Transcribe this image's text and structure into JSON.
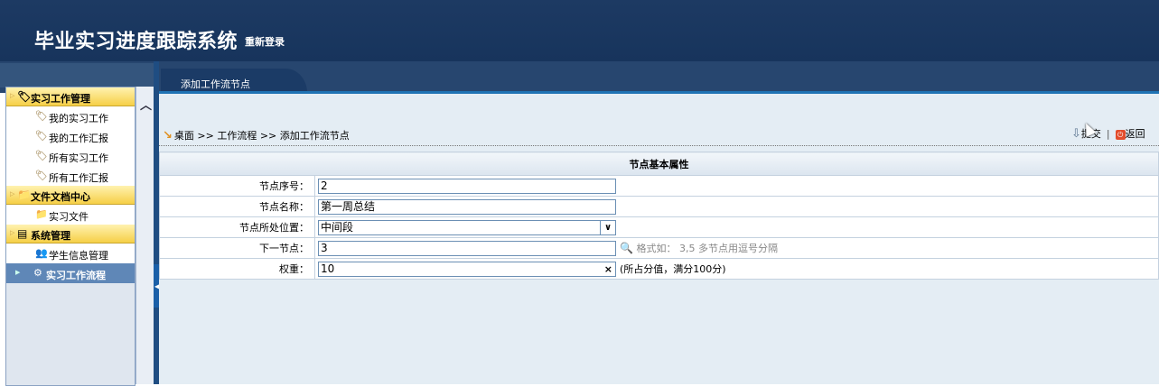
{
  "header": {
    "title": "毕业实习进度跟踪系统",
    "relogin": "重新登录"
  },
  "tab": {
    "label": "添加工作流节点"
  },
  "sidebar": {
    "sections": [
      {
        "label": "实习工作管理",
        "icon": "tag-icon",
        "items": [
          {
            "label": "我的实习工作"
          },
          {
            "label": "我的工作汇报"
          },
          {
            "label": "所有实习工作"
          },
          {
            "label": "所有工作汇报"
          }
        ]
      },
      {
        "label": "文件文档中心",
        "icon": "folder-icon",
        "items": [
          {
            "label": "实习文件"
          }
        ]
      },
      {
        "label": "系统管理",
        "icon": "window-icon",
        "items": [
          {
            "label": "学生信息管理"
          },
          {
            "label": "实习工作流程"
          }
        ]
      }
    ]
  },
  "breadcrumb": "桌面 >> 工作流程 >> 添加工作流节点",
  "actions": {
    "submit": "提交",
    "back": "返回"
  },
  "form": {
    "section_title": "节点基本属性",
    "fields": [
      {
        "label": "节点序号：",
        "value": "2"
      },
      {
        "label": "节点名称：",
        "value": "第一周总结"
      },
      {
        "label": "节点所处位置：",
        "value": "中间段"
      },
      {
        "label": "下一节点：",
        "value": "3",
        "hint": "格式如： 3,5 多节点用逗号分隔"
      },
      {
        "label": "权重：",
        "value": "10",
        "note": "(所占分值，满分100分)"
      }
    ]
  },
  "colors": {
    "header": "#1d3a63",
    "section_head": "#f6cf47",
    "active_item": "#5f87b7",
    "content_bg": "#e4edf4"
  }
}
